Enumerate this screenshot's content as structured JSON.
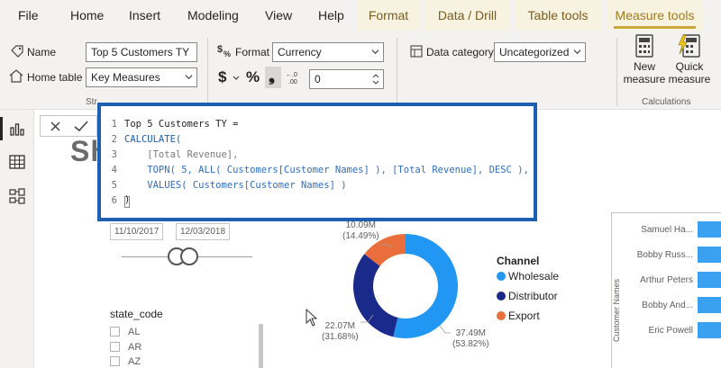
{
  "menu": {
    "file": "File",
    "home": "Home",
    "insert": "Insert",
    "modeling": "Modeling",
    "view": "View",
    "help": "Help",
    "format": "Format",
    "data_drill": "Data / Drill",
    "table_tools": "Table tools",
    "measure_tools": "Measure tools"
  },
  "ribbon": {
    "name_label": "Name",
    "name_value": "Top 5 Customers TY",
    "home_table_label": "Home table",
    "home_table_value": "Key Measures",
    "format_label": "Format",
    "format_value": "Currency",
    "dollar": "$",
    "percent": "%",
    "comma": "❟",
    "decimals_value": "0",
    "data_category_label": "Data category",
    "data_category_value": "Uncategorized",
    "new_measure": "New measure",
    "quick_measure": "Quick measure",
    "calculations_group": "Calculations",
    "structure_group": "Str"
  },
  "editor": {
    "lines": [
      {
        "n": "1",
        "text": "Top 5 Customers TY ="
      },
      {
        "n": "2",
        "text": "CALCULATE("
      },
      {
        "n": "3",
        "text": "    [Total Revenue],"
      },
      {
        "n": "4",
        "text": "    TOPN( 5, ALL( Customers[Customer Names] ), [Total Revenue], DESC ),"
      },
      {
        "n": "5",
        "text": "    VALUES( Customers[Customer Names] )"
      },
      {
        "n": "6",
        "text": ")"
      }
    ]
  },
  "canvas": {
    "big_title": "Sh",
    "date_start": "11/10/2017",
    "date_end": "12/03/2018",
    "slicer_title": "state_code",
    "states": [
      "AL",
      "AR",
      "AZ"
    ]
  },
  "chart_data": {
    "type": "pie",
    "categories": [
      "Wholesale",
      "Distributor",
      "Export"
    ],
    "values": [
      37.49,
      22.07,
      10.09
    ],
    "value_labels": [
      "37.49M",
      "22.07M",
      "10.09M"
    ],
    "percent_labels": [
      "(53.82%)",
      "(31.68%)",
      "(14.49%)"
    ],
    "percents": [
      53.82,
      31.68,
      14.49
    ],
    "colors": [
      "#2196f3",
      "#1a2a8a",
      "#e96e3c"
    ],
    "legend_title": "Channel",
    "legend_position": "right",
    "donut": true
  },
  "customers": {
    "axis_label": "Customer Names",
    "names": [
      "Samuel Ha...",
      "Bobby Russ...",
      "Arthur Peters",
      "Bobby And...",
      "Eric Powell"
    ]
  },
  "colors": {
    "accent": "#1e5fb4",
    "context_tab_bg": "#f7f3e0",
    "bar": "#3aa0f0"
  },
  "icons": {
    "name": "tag-icon",
    "home_table": "home-icon",
    "format": "currency-format-icon",
    "data_category": "category-icon",
    "new_measure": "calculator-icon",
    "quick_measure": "lightning-calculator-icon",
    "rail_report": "report-icon",
    "rail_data": "table-icon",
    "rail_model": "model-icon",
    "cancel": "close-icon",
    "commit": "check-icon"
  }
}
